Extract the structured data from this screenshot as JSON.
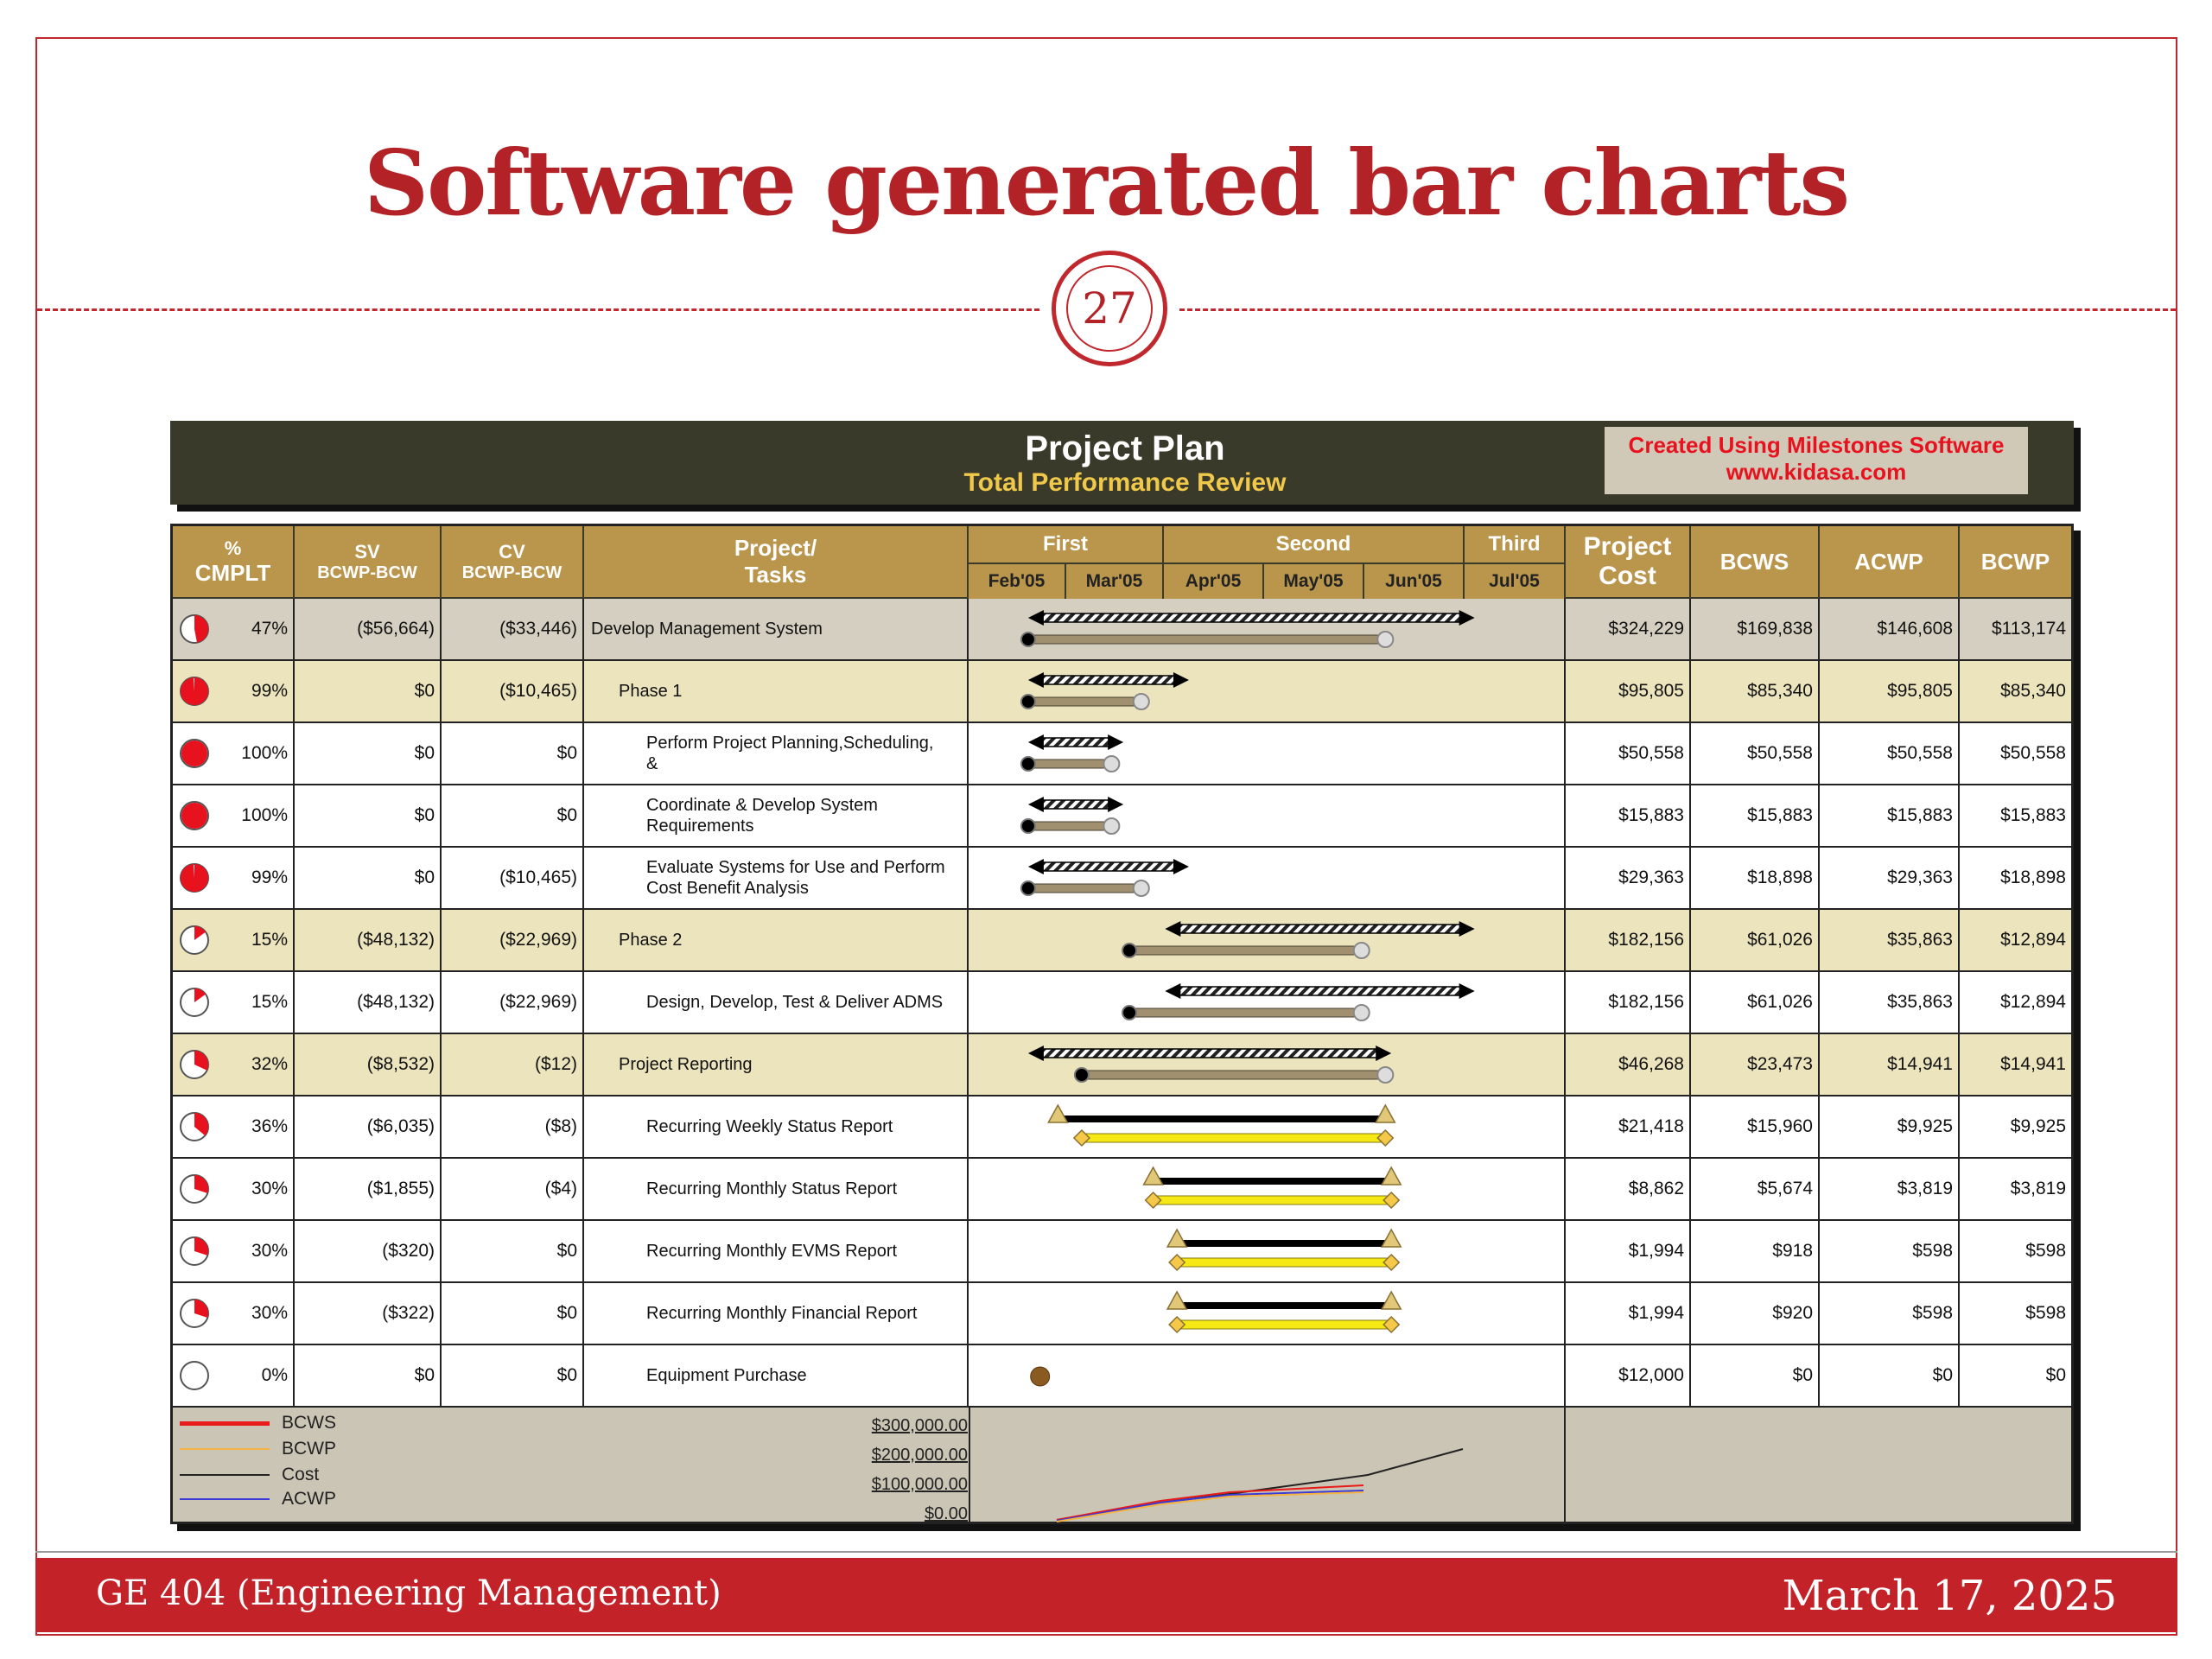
{
  "slide": {
    "title": "Software generated bar charts",
    "page_number": "27",
    "footer_left": "GE 404 (Engineering Management)",
    "footer_right": "March 17, 2025"
  },
  "chart_header": {
    "title": "Project Plan",
    "subtitle": "Total Performance Review",
    "brand_line1": "Created Using Milestones Software",
    "brand_line2": "www.kidasa.com"
  },
  "columns": {
    "pct_1": "%",
    "pct_2": "CMPLT",
    "sv_1": "SV",
    "sv_2": "BCWP-BCW",
    "cv_1": "CV",
    "cv_2": "BCWP-BCW",
    "tasks_1": "Project/",
    "tasks_2": "Tasks",
    "period_first": "First",
    "period_second": "Second",
    "period_third": "Third",
    "months": [
      "Feb'05",
      "Mar'05",
      "Apr'05",
      "May'05",
      "Jun'05",
      "Jul'05"
    ],
    "cost_1": "Project",
    "cost_2": "Cost",
    "bcws": "BCWS",
    "acwp": "ACWP",
    "bcwp": "BCWP"
  },
  "rows": [
    {
      "pct": "47%",
      "pie": 0.47,
      "sv": "($56,664)",
      "cv": "($33,446)",
      "task": "Develop Management System",
      "indent": 0,
      "cost": "$324,229",
      "bcws": "$169,838",
      "acwp": "$146,608",
      "bcwp": "$113,174",
      "shade": "gray",
      "type": "summary",
      "plan": [
        0.1,
        0.85
      ],
      "actual": [
        0.1,
        0.7
      ]
    },
    {
      "pct": "99%",
      "pie": 0.99,
      "sv": "$0",
      "cv": "($10,465)",
      "task": "Phase 1",
      "indent": 1,
      "cost": "$95,805",
      "bcws": "$85,340",
      "acwp": "$95,805",
      "bcwp": "$85,340",
      "shade": "tan",
      "type": "summary",
      "plan": [
        0.1,
        0.37
      ],
      "actual": [
        0.1,
        0.29
      ]
    },
    {
      "pct": "100%",
      "pie": 1.0,
      "sv": "$0",
      "cv": "$0",
      "task": "Perform Project Planning,Scheduling, &",
      "indent": 2,
      "cost": "$50,558",
      "bcws": "$50,558",
      "acwp": "$50,558",
      "bcwp": "$50,558",
      "shade": "white",
      "type": "summary",
      "plan": [
        0.1,
        0.26
      ],
      "actual": [
        0.1,
        0.24
      ]
    },
    {
      "pct": "100%",
      "pie": 1.0,
      "sv": "$0",
      "cv": "$0",
      "task": "Coordinate & Develop System Requirements",
      "indent": 2,
      "cost": "$15,883",
      "bcws": "$15,883",
      "acwp": "$15,883",
      "bcwp": "$15,883",
      "shade": "white",
      "type": "summary",
      "plan": [
        0.1,
        0.26
      ],
      "actual": [
        0.1,
        0.24
      ]
    },
    {
      "pct": "99%",
      "pie": 0.99,
      "sv": "$0",
      "cv": "($10,465)",
      "task": "Evaluate Systems for Use and Perform Cost Benefit Analysis",
      "indent": 2,
      "cost": "$29,363",
      "bcws": "$18,898",
      "acwp": "$29,363",
      "bcwp": "$18,898",
      "shade": "white",
      "type": "summary",
      "plan": [
        0.1,
        0.37
      ],
      "actual": [
        0.1,
        0.29
      ]
    },
    {
      "pct": "15%",
      "pie": 0.15,
      "sv": "($48,132)",
      "cv": "($22,969)",
      "task": "Phase 2",
      "indent": 1,
      "cost": "$182,156",
      "bcws": "$61,026",
      "acwp": "$35,863",
      "bcwp": "$12,894",
      "shade": "tan",
      "type": "summary",
      "plan": [
        0.33,
        0.85
      ],
      "actual": [
        0.27,
        0.66
      ]
    },
    {
      "pct": "15%",
      "pie": 0.15,
      "sv": "($48,132)",
      "cv": "($22,969)",
      "task": "Design, Develop, Test & Deliver ADMS",
      "indent": 2,
      "cost": "$182,156",
      "bcws": "$61,026",
      "acwp": "$35,863",
      "bcwp": "$12,894",
      "shade": "white",
      "type": "summary",
      "plan": [
        0.33,
        0.85
      ],
      "actual": [
        0.27,
        0.66
      ]
    },
    {
      "pct": "32%",
      "pie": 0.32,
      "sv": "($8,532)",
      "cv": "($12)",
      "task": "Project Reporting",
      "indent": 1,
      "cost": "$46,268",
      "bcws": "$23,473",
      "acwp": "$14,941",
      "bcwp": "$14,941",
      "shade": "tan",
      "type": "summary",
      "plan": [
        0.1,
        0.71
      ],
      "actual": [
        0.19,
        0.7
      ]
    },
    {
      "pct": "36%",
      "pie": 0.36,
      "sv": "($6,035)",
      "cv": "($8)",
      "task": "Recurring Weekly Status Report",
      "indent": 2,
      "cost": "$21,418",
      "bcws": "$15,960",
      "acwp": "$9,925",
      "bcwp": "$9,925",
      "shade": "white",
      "type": "task",
      "plan": [
        0.15,
        0.7
      ],
      "actual": [
        0.19,
        0.7
      ]
    },
    {
      "pct": "30%",
      "pie": 0.3,
      "sv": "($1,855)",
      "cv": "($4)",
      "task": "Recurring Monthly Status Report",
      "indent": 2,
      "cost": "$8,862",
      "bcws": "$5,674",
      "acwp": "$3,819",
      "bcwp": "$3,819",
      "shade": "white",
      "type": "task",
      "plan": [
        0.31,
        0.71
      ],
      "actual": [
        0.31,
        0.71
      ]
    },
    {
      "pct": "30%",
      "pie": 0.3,
      "sv": "($320)",
      "cv": "$0",
      "task": "Recurring Monthly EVMS Report",
      "indent": 2,
      "cost": "$1,994",
      "bcws": "$918",
      "acwp": "$598",
      "bcwp": "$598",
      "shade": "white",
      "type": "task",
      "plan": [
        0.35,
        0.71
      ],
      "actual": [
        0.35,
        0.71
      ]
    },
    {
      "pct": "30%",
      "pie": 0.3,
      "sv": "($322)",
      "cv": "$0",
      "task": "Recurring Monthly Financial Report",
      "indent": 2,
      "cost": "$1,994",
      "bcws": "$920",
      "acwp": "$598",
      "bcwp": "$598",
      "shade": "white",
      "type": "task",
      "plan": [
        0.35,
        0.71
      ],
      "actual": [
        0.35,
        0.71
      ]
    },
    {
      "pct": "0%",
      "pie": 0.0,
      "sv": "$0",
      "cv": "$0",
      "task": "Equipment Purchase",
      "indent": 2,
      "cost": "$12,000",
      "bcws": "$0",
      "acwp": "$0",
      "bcwp": "$0",
      "shade": "white",
      "type": "milestone",
      "plan": [
        0.12,
        0.12
      ],
      "actual": [
        0.12,
        0.12
      ]
    }
  ],
  "legend": [
    {
      "label": "BCWS",
      "color": "#e81a1a"
    },
    {
      "label": "BCWP",
      "color": "#f5b342"
    },
    {
      "label": "Cost",
      "color": "#222222"
    },
    {
      "label": "ACWP",
      "color": "#3a3ad8"
    }
  ],
  "y_axis_labels": [
    "$300,000.00",
    "$200,000.00",
    "$100,000.00",
    "$0.00"
  ],
  "colors": {
    "header_dark": "#3a3a2a",
    "header_tan": "#b9964c",
    "accent_red": "#c0282d",
    "row_gray": "#d4cfc0",
    "row_tan": "#ebe4bd",
    "pie_red": "#e8121f"
  }
}
